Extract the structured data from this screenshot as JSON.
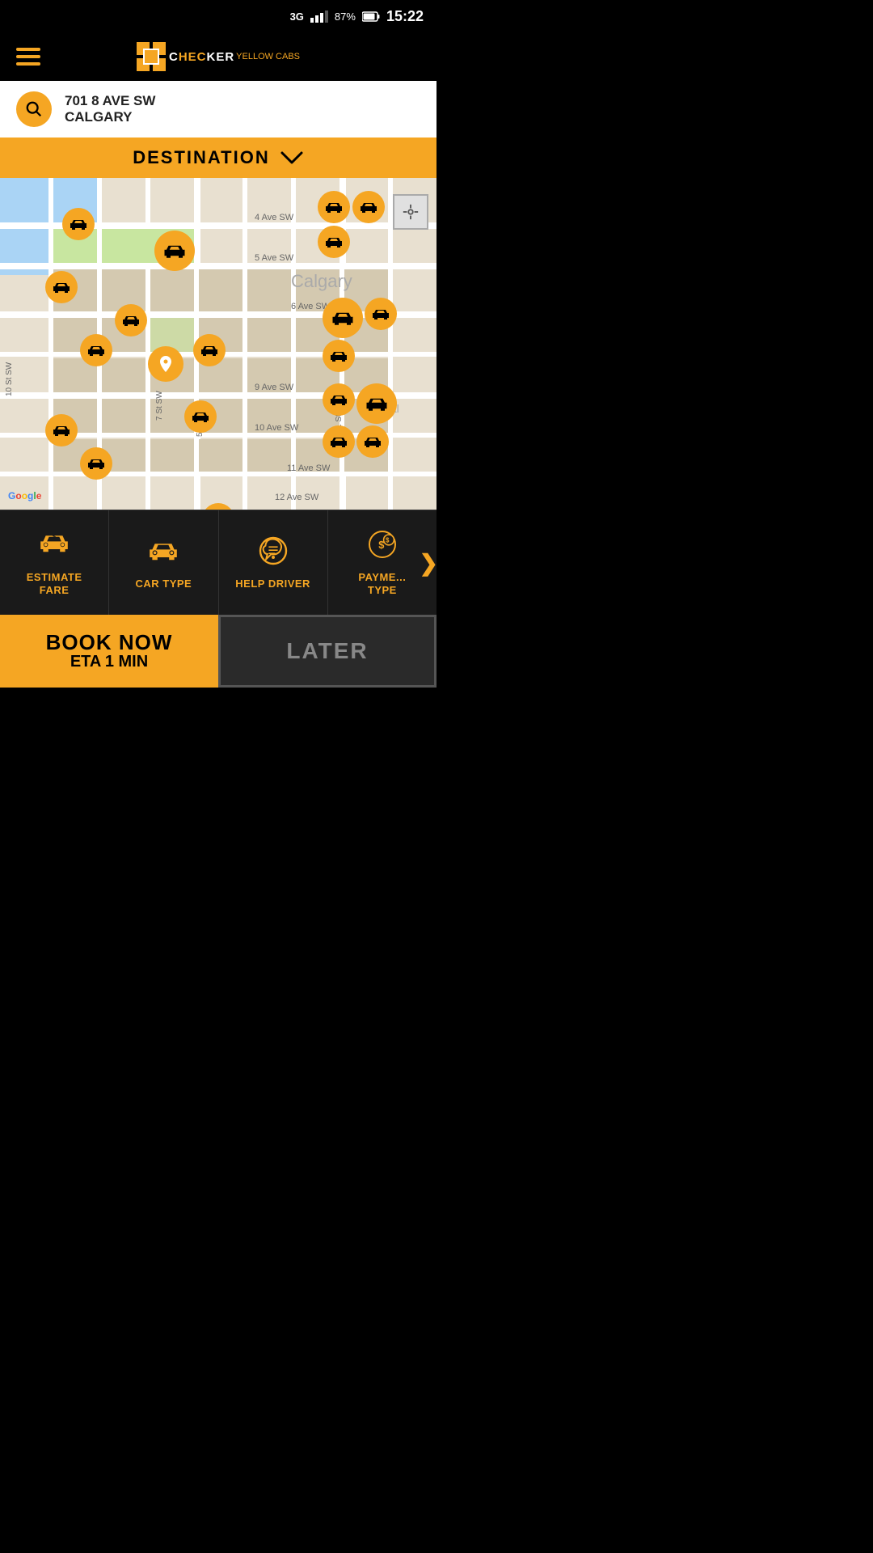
{
  "statusBar": {
    "network": "3G",
    "signal": 4,
    "battery": "87%",
    "time": "15:22"
  },
  "header": {
    "menuLabel": "menu",
    "logoText": "CHECKER YELLOW CABS"
  },
  "locationBar": {
    "address": "701 8 AVE SW",
    "city": "CALGARY"
  },
  "destinationBar": {
    "label": "DESTINATION",
    "chevron": "∨"
  },
  "map": {
    "googleWatermark": "Google",
    "streetLabels": [
      "4 Ave SW",
      "5 Ave SW",
      "6 Ave SW",
      "9 Ave SW",
      "10 Ave SW",
      "11 Ave SW",
      "12 Ave SW",
      "Calgary"
    ]
  },
  "actionBar": {
    "items": [
      {
        "id": "estimate-fare",
        "label": "ESTIMATE\nFARE",
        "labelLine1": "ESTIMATE",
        "labelLine2": "FARE"
      },
      {
        "id": "car-type",
        "label": "CAR TYPE",
        "labelLine1": "CAR TYPE",
        "labelLine2": ""
      },
      {
        "id": "help-driver",
        "label": "HELP DRIVER",
        "labelLine1": "HELP DRIVER",
        "labelLine2": ""
      },
      {
        "id": "payment-type",
        "label": "PAYMENT\nTYPE",
        "labelLine1": "PAYME...",
        "labelLine2": "TYPE"
      }
    ],
    "nextArrow": "❯"
  },
  "bookBar": {
    "bookNowLabel": "BOOK NOW",
    "etaLabel": "ETA",
    "etaValue": "1 MIN",
    "laterLabel": "LATER"
  }
}
